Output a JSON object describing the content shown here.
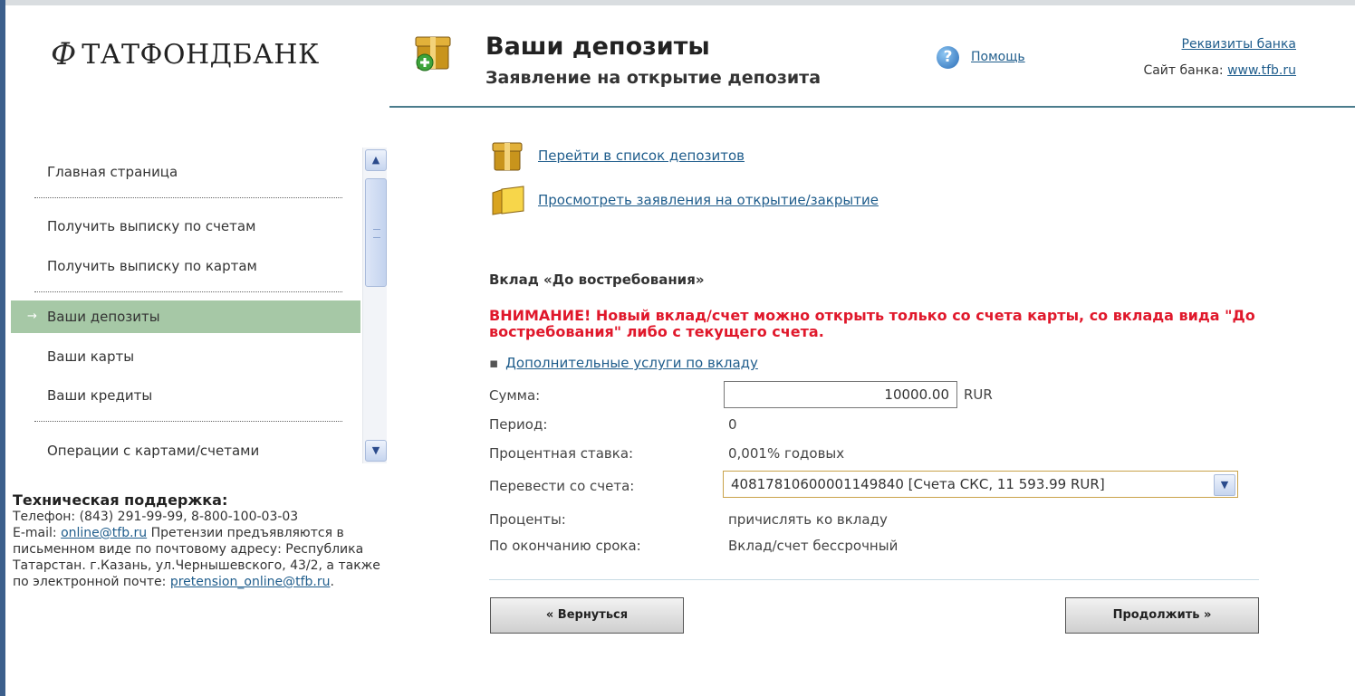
{
  "header": {
    "logo_mark": "Ф",
    "logo_text": "ТАТФОНДБАНК",
    "title": "Ваши депозиты",
    "subtitle": "Заявление на открытие депозита",
    "help_link": "Помощь",
    "bank_details_link": "Реквизиты банка",
    "site_label": "Сайт банка:",
    "site_link": "www.tfb.ru"
  },
  "sidebar": {
    "items": [
      {
        "label": "Главная страница"
      },
      {
        "label": "Получить выписку по счетам"
      },
      {
        "label": "Получить выписку по картам"
      },
      {
        "label": "Ваши депозиты",
        "active": true
      },
      {
        "label": "Ваши карты"
      },
      {
        "label": "Ваши кредиты"
      },
      {
        "label": "Операции с картами/счетами"
      }
    ]
  },
  "support": {
    "title": "Техническая поддержка:",
    "phone_line": "Телефон: (843) 291-99-99, 8-800-100-03-03",
    "email_label": "E-mail:",
    "email": "online@tfb.ru",
    "claims_text": "Претензии предъявляются в письменном виде по почтовому адресу: Республика Татарстан. г.Казань, ул.Чернышевского, 43/2, а также по электронной почте:",
    "claims_email": "pretension_online@tfb.ru"
  },
  "main": {
    "link_deposits": "Перейти в список депозитов",
    "link_applications": "Просмотреть заявления на открытие/закрытие",
    "deposit_title": "Вклад «До востребования»",
    "warning": "ВНИМАНИЕ! Новый вклад/счет можно открыть только со счета карты, со вклада вида \"До востребования\" либо с текущего счета.",
    "extra_link": "Дополнительные услуги по вкладу",
    "form": {
      "amount_label": "Сумма:",
      "amount_value": "10000.00",
      "currency": "RUR",
      "period_label": "Период:",
      "period_value": "0",
      "rate_label": "Процентная ставка:",
      "rate_value": "0,001% годовых",
      "from_account_label": "Перевести со счета:",
      "from_account_value": "40817810600001149840 [Счета СКС, 11 593.99 RUR]",
      "interest_label": "Проценты:",
      "interest_value": "причислять ко вкладу",
      "maturity_label": "По окончанию срока:",
      "maturity_value": "Вклад/счет бессрочный"
    },
    "back_button": "« Вернуться",
    "next_button": "Продолжить »"
  }
}
